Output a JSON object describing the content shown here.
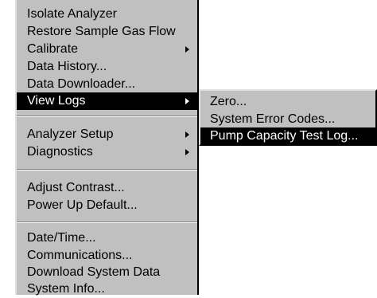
{
  "main_menu": {
    "items": [
      {
        "label": "Isolate Analyzer"
      },
      {
        "label": "Restore Sample Gas Flow"
      },
      {
        "label": "Calibrate"
      },
      {
        "label": "Data History..."
      },
      {
        "label": "Data Downloader..."
      },
      {
        "label": "View Logs"
      },
      {
        "label": "Analyzer Setup"
      },
      {
        "label": "Diagnostics"
      },
      {
        "label": "Adjust Contrast..."
      },
      {
        "label": "Power Up Default..."
      },
      {
        "label": "Date/Time..."
      },
      {
        "label": "Communications..."
      },
      {
        "label": "Download System Data"
      },
      {
        "label": "System Info..."
      }
    ]
  },
  "sub_menu": {
    "items": [
      {
        "label": "Zero..."
      },
      {
        "label": "System Error Codes..."
      },
      {
        "label": "Pump Capacity Test Log..."
      }
    ]
  },
  "colors": {
    "menu_background": "#c0c0c0",
    "highlight_background": "#000000",
    "highlight_text": "#ffffff"
  }
}
